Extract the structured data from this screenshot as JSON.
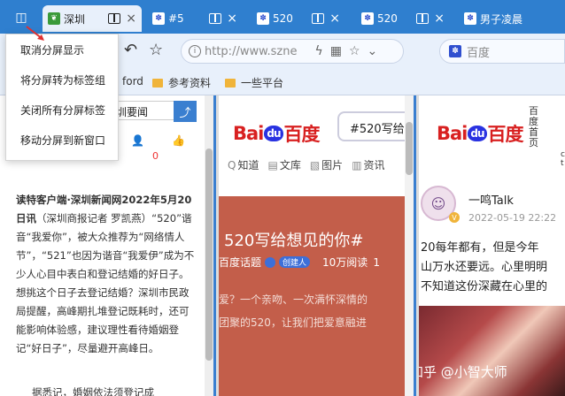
{
  "tabstrip": {
    "tabs": [
      {
        "title": "深圳",
        "icon": "leaf-favicon",
        "active": true
      },
      {
        "title": "#5",
        "icon": "baidu-paw-favicon",
        "active": false
      },
      {
        "title": "520",
        "icon": "baidu-paw-favicon",
        "active": false
      },
      {
        "title": "520",
        "icon": "baidu-paw-favicon",
        "active": false
      },
      {
        "title": "男子凌晨",
        "icon": "baidu-paw-favicon",
        "active": false
      }
    ],
    "close_glyph": "×",
    "split_toggle_glyph": "◫"
  },
  "toolbar": {
    "back_glyph": "↶",
    "star_glyph": "☆",
    "address": "http://www.szne",
    "info_glyph": "i",
    "flash_glyph": "ϟ",
    "grid_glyph": "▦",
    "addr_star_glyph": "☆",
    "dropdown_glyph": "⌄",
    "search_placeholder": "百度",
    "paw_glyph": "🐾"
  },
  "bookmarks": [
    {
      "label": "ford"
    },
    {
      "label": "参考资料"
    },
    {
      "label": "一些平台"
    }
  ],
  "context_menu": {
    "items": [
      "取消分屏显示",
      "将分屏转为标签组",
      "关闭所有分屏标签",
      "移动分屏到新窗口"
    ]
  },
  "pane1": {
    "search_value": "圳要闻",
    "share_glyph": "⤴",
    "avatar_glyph": "👤",
    "like_glyph": "👍",
    "like_count": "0",
    "article_lead": "读特客户端·深圳新闻网2022年5月20日讯",
    "article_byline": "（深圳商报记者 罗凯燕）",
    "article_body": "“520”谐音“我爱你”，被大众推荐为“网络情人节”，“521”也因为谐音“我爱伊”成为不少人心目中表白和登记结婚的好日子。想挑这个日子去登记结婚？深圳市民政局提醒，高峰期扎堆登记既耗时，还可能影响体验感，建议理性看待婚姻登记“好日子”，尽量避开高峰日。",
    "article_more": "据悉记，婚姻依法须登记成"
  },
  "pane2": {
    "logo_bai": "Bai",
    "logo_du": "du",
    "logo_text": "百度",
    "search_value": "#520写给",
    "nav": [
      {
        "icon": "Q",
        "label": "知道"
      },
      {
        "icon": "▤",
        "label": "文库"
      },
      {
        "icon": "▧",
        "label": "图片"
      },
      {
        "icon": "▥",
        "label": "资讯"
      }
    ],
    "topic_title": "520写给想见的你#",
    "topic_source": "百度话题",
    "topic_badge": "创建人",
    "topic_reads": "10万阅读",
    "topic_reads_suffix": "1",
    "topic_desc_line1": "爱？一个亲吻、一次满怀深情的",
    "topic_desc_line2": "团聚的520，让我们把爱意融进"
  },
  "pane3": {
    "side_text": "百度首页",
    "dot1": "c",
    "dot2": "t",
    "author": "一鸣Talk",
    "time": "2022-05-19 22:22",
    "body_line1": "20每年都有，但是今年",
    "body_line2": "山万水还要远。心里明明",
    "body_line3": "不知道这份深藏在心里的",
    "watermark": "知乎 @小智大师"
  }
}
